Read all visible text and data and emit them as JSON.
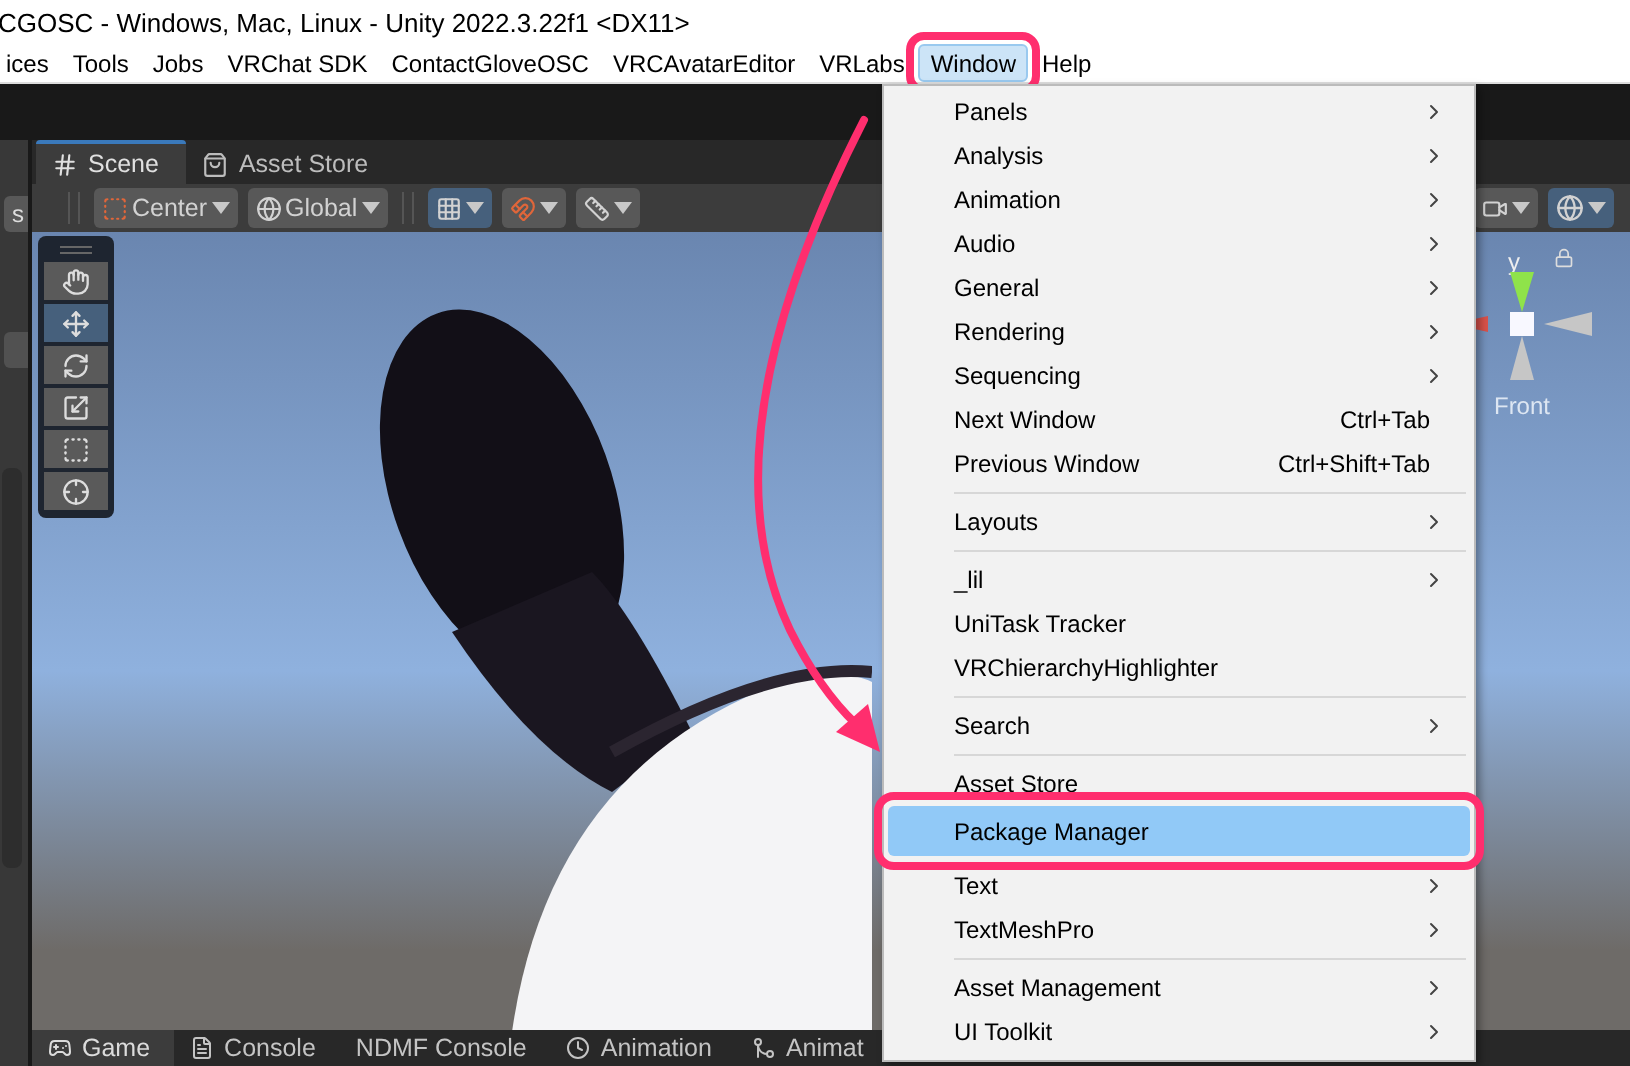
{
  "window": {
    "title": "CGOSC - Windows, Mac, Linux - Unity 2022.3.22f1 <DX11>"
  },
  "menu_bar": [
    {
      "label": "ices",
      "selected": false,
      "callout": false
    },
    {
      "label": "Tools",
      "selected": false,
      "callout": false
    },
    {
      "label": "Jobs",
      "selected": false,
      "callout": false
    },
    {
      "label": "VRChat SDK",
      "selected": false,
      "callout": false
    },
    {
      "label": "ContactGloveOSC",
      "selected": false,
      "callout": false
    },
    {
      "label": "VRCAvatarEditor",
      "selected": false,
      "callout": false
    },
    {
      "label": "VRLabs",
      "selected": false,
      "callout": false
    },
    {
      "label": "Window",
      "selected": true,
      "callout": true
    },
    {
      "label": "Help",
      "selected": false,
      "callout": false
    }
  ],
  "left_panel": {
    "button": "s"
  },
  "scene_panel": {
    "tabs": [
      {
        "label": "Scene",
        "kind": "scene",
        "selected": true
      },
      {
        "label": "Asset Store",
        "kind": "store",
        "selected": false
      }
    ],
    "toolbar": {
      "pivot": "Center",
      "space": "Global",
      "grid_visible": true,
      "gizmos_on": true
    },
    "tools": [
      {
        "kind": "hand",
        "selected": false
      },
      {
        "kind": "move",
        "selected": true
      },
      {
        "kind": "rotate",
        "selected": false
      },
      {
        "kind": "scale",
        "selected": false
      },
      {
        "kind": "rect",
        "selected": false
      },
      {
        "kind": "transform",
        "selected": false
      }
    ],
    "gizmo": {
      "axis": "y",
      "view": "Front"
    }
  },
  "bottom_tabs": [
    {
      "label": "Game",
      "kind": "game",
      "selected": true
    },
    {
      "label": "Console",
      "kind": "console",
      "selected": false
    },
    {
      "label": "NDMF Console",
      "kind": "plain",
      "selected": false
    },
    {
      "label": "Animation",
      "kind": "animation",
      "selected": false
    },
    {
      "label": "Animat",
      "kind": "animator",
      "selected": false
    }
  ],
  "window_menu": {
    "items": [
      {
        "kind": "submenu",
        "label": "Panels",
        "highlighted": false,
        "callout": false
      },
      {
        "kind": "submenu",
        "label": "Analysis",
        "highlighted": false,
        "callout": false
      },
      {
        "kind": "submenu",
        "label": "Animation",
        "highlighted": false,
        "callout": false
      },
      {
        "kind": "submenu",
        "label": "Audio",
        "highlighted": false,
        "callout": false
      },
      {
        "kind": "submenu",
        "label": "General",
        "highlighted": false,
        "callout": false
      },
      {
        "kind": "submenu",
        "label": "Rendering",
        "highlighted": false,
        "callout": false
      },
      {
        "kind": "submenu",
        "label": "Sequencing",
        "highlighted": false,
        "callout": false
      },
      {
        "kind": "command",
        "label": "Next Window",
        "shortcut": "Ctrl+Tab",
        "highlighted": false,
        "callout": false
      },
      {
        "kind": "command",
        "label": "Previous Window",
        "shortcut": "Ctrl+Shift+Tab",
        "highlighted": false,
        "callout": false
      },
      {
        "kind": "separator"
      },
      {
        "kind": "submenu",
        "label": "Layouts",
        "highlighted": false,
        "callout": false
      },
      {
        "kind": "separator"
      },
      {
        "kind": "submenu",
        "label": "_lil",
        "highlighted": false,
        "callout": false
      },
      {
        "kind": "command",
        "label": "UniTask Tracker",
        "highlighted": false,
        "callout": false
      },
      {
        "kind": "command",
        "label": "VRChierarchyHighlighter",
        "highlighted": false,
        "callout": false
      },
      {
        "kind": "separator"
      },
      {
        "kind": "submenu",
        "label": "Search",
        "highlighted": false,
        "callout": false
      },
      {
        "kind": "separator"
      },
      {
        "kind": "command",
        "label": "Asset Store",
        "highlighted": false,
        "callout": false
      },
      {
        "kind": "command",
        "label": "Package Manager",
        "highlighted": true,
        "callout": true
      },
      {
        "kind": "submenu",
        "label": "Text",
        "highlighted": false,
        "callout": false
      },
      {
        "kind": "submenu",
        "label": "TextMeshPro",
        "highlighted": false,
        "callout": false
      },
      {
        "kind": "separator"
      },
      {
        "kind": "submenu",
        "label": "Asset Management",
        "highlighted": false,
        "callout": false
      },
      {
        "kind": "submenu",
        "label": "UI Toolkit",
        "highlighted": false,
        "callout": false
      }
    ]
  }
}
